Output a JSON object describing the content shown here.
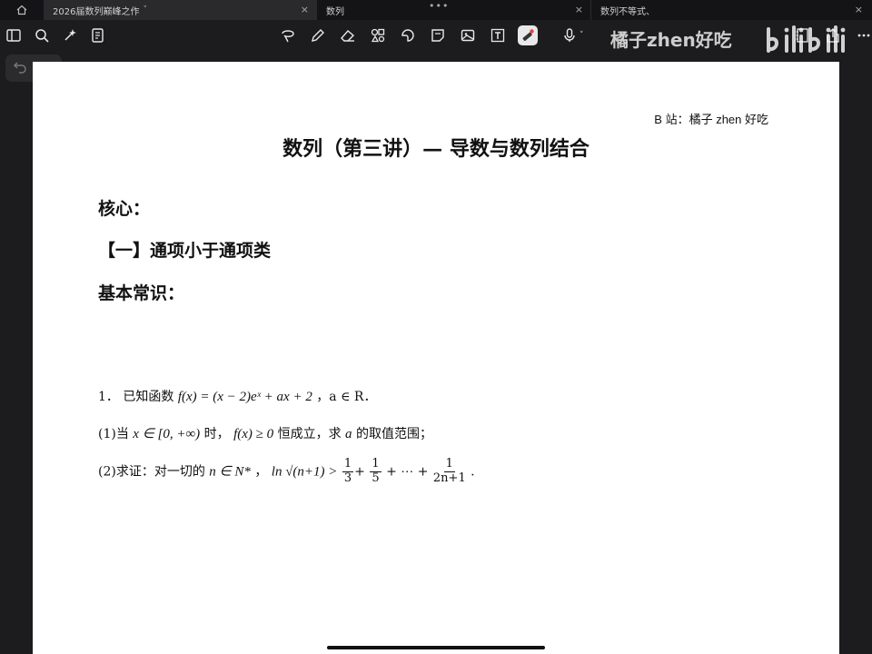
{
  "tabs": [
    {
      "label": "2026届数列巅峰之作",
      "active": true,
      "chevron": "˅",
      "close": "×"
    },
    {
      "label": "数列",
      "active": false,
      "close": "×"
    },
    {
      "label": "数列不等式、",
      "active": false,
      "close": "×"
    }
  ],
  "tab_overflow": "•••",
  "watermark": {
    "text": "橘子zhen好吃",
    "brand": "bilibili"
  },
  "icons": {
    "home": "home-icon",
    "sidebar": "sidebar-icon",
    "search": "search-icon",
    "magic": "sparkle-icon",
    "bookmark": "notes-icon",
    "lasso": "lasso-icon",
    "pen": "pen-icon",
    "eraser": "eraser-icon",
    "shapes": "shapes-icon",
    "sticker": "sticker-icon",
    "note": "sticky-note-icon",
    "image": "image-icon",
    "text": "text-box-icon",
    "laser": "laser-pointer-icon",
    "mic": "microphone-icon",
    "undo": "undo-icon",
    "redo": "redo-icon"
  },
  "colors": {
    "active_tool_bg": "#e8e8e8",
    "laser_accent": "#e0413a",
    "page": "#ffffff"
  },
  "document": {
    "credit": "B 站：橘子 zhen 好吃",
    "title": "数列（第三讲）— 导数与数列结合",
    "heading_core": "核心：",
    "heading_section1": "【一】通项小于通项类",
    "heading_basic": "基本常识：",
    "problem": {
      "number": "1．",
      "stem_prefix": "已知函数",
      "stem_math": "f(x) = (x − 2)eˣ + ax + 2",
      "stem_suffix": "，a ∈ R．",
      "part1_label": "(1)当",
      "part1_cond": "x ∈ [0, +∞)",
      "part1_mid": "时，",
      "part1_ineq": "f(x) ≥ 0",
      "part1_text": "恒成立，求",
      "part1_var": "a",
      "part1_end": "的取值范围；",
      "part2_label": "(2)求证：对一切的",
      "part2_cond": "n ∈ N*",
      "part2_sep": "，",
      "part2_lhs": "ln √(n+1) >",
      "frac1_num": "1",
      "frac1_den": "3",
      "frac2_num": "1",
      "frac2_den": "5",
      "ellipsis": "+ ⋯ +",
      "frac3_num": "1",
      "frac3_den": "2n+1",
      "part2_end": "."
    }
  }
}
